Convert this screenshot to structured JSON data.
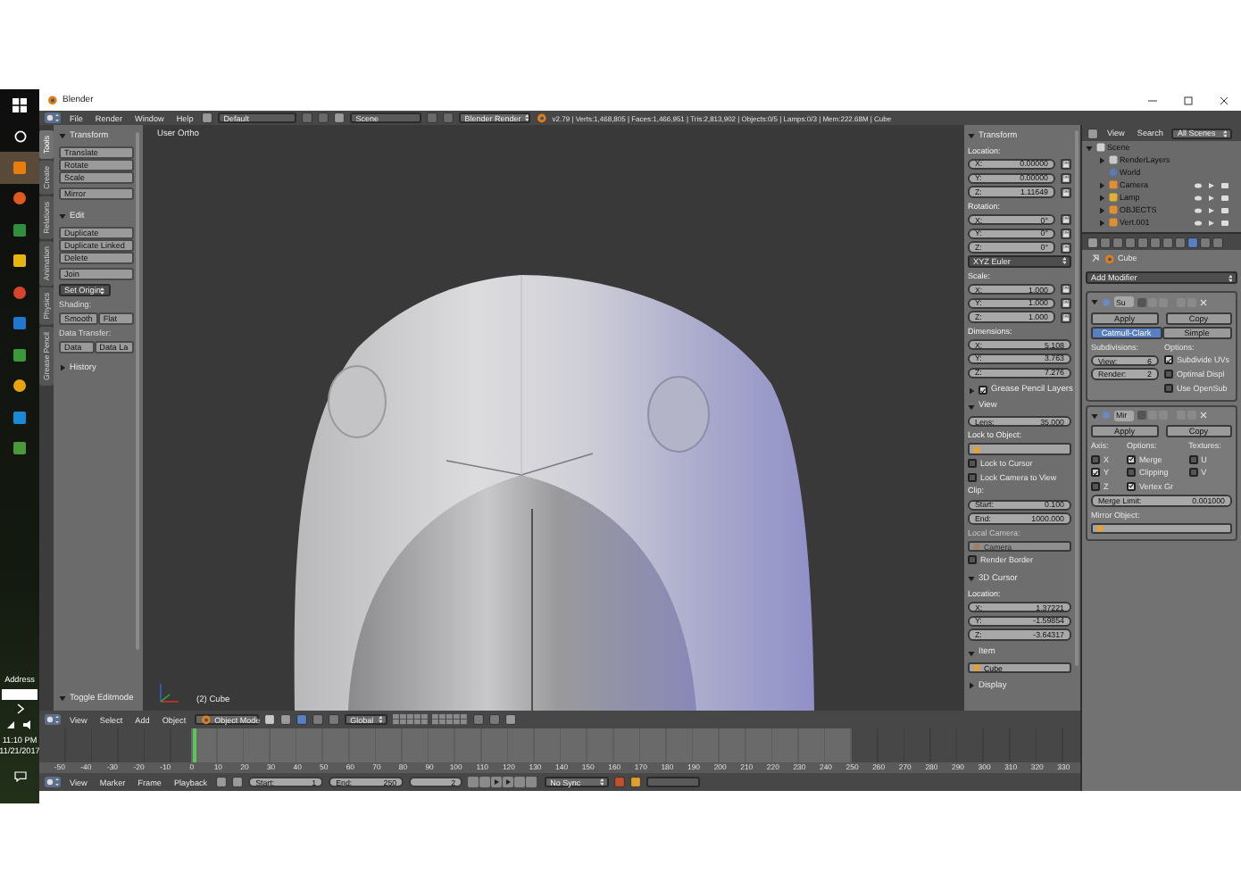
{
  "taskbar": {
    "apps": [
      {
        "selected": true
      },
      {
        "selected": false
      },
      {
        "selected": false
      },
      {
        "selected": false
      },
      {
        "selected": false
      },
      {
        "selected": false
      },
      {
        "selected": false
      },
      {
        "selected": false
      },
      {
        "selected": false
      },
      {
        "selected": false
      }
    ],
    "address_label": "Address",
    "time": "11:10 PM",
    "date": "11/21/2017"
  },
  "window": {
    "title": "Blender"
  },
  "info_header": {
    "menus": [
      "File",
      "Render",
      "Window",
      "Help"
    ],
    "layout": "Default",
    "scene": "Scene",
    "engine": "Blender Render",
    "stats": "v2.79 | Verts:1,468,805 | Faces:1,466,951 | Tris:2,813,902 | Objects:0/5 | Lamps:0/3 | Mem:222.68M | Cube"
  },
  "tool_shelf": {
    "tabs": [
      {
        "label": "Tools",
        "selected": true
      },
      {
        "label": "Create",
        "selected": false
      },
      {
        "label": "Relations",
        "selected": false
      },
      {
        "label": "Animation",
        "selected": false
      },
      {
        "label": "Physics",
        "selected": false
      },
      {
        "label": "Grease Pencil",
        "selected": false
      }
    ],
    "panels": [
      {
        "title": "Transform",
        "expanded": true,
        "items": [
          {
            "kind": "column",
            "labels": [
              "Translate",
              "Rotate",
              "Scale"
            ]
          },
          {
            "kind": "column",
            "labels": [
              "Mirror"
            ]
          }
        ]
      },
      {
        "title": "Edit",
        "expanded": true,
        "items": [
          {
            "kind": "column",
            "labels": [
              "Duplicate",
              "Duplicate Linked",
              "Delete"
            ]
          },
          {
            "kind": "column",
            "labels": [
              "Join"
            ]
          },
          {
            "kind": "dropdown",
            "label": "Set Origin"
          },
          {
            "kind": "label",
            "text": "Shading:"
          },
          {
            "kind": "row",
            "labels": [
              "Smooth",
              "Flat"
            ]
          },
          {
            "kind": "label",
            "text": "Data Transfer:"
          },
          {
            "kind": "row",
            "labels": [
              "Data",
              "Data La"
            ]
          }
        ]
      },
      {
        "title": "History",
        "expanded": false
      }
    ],
    "operator_panel": {
      "title": "Toggle Editmode",
      "expanded": true
    }
  },
  "viewport": {
    "view_label": "User Ortho",
    "object_label": "(2) Cube"
  },
  "n_panel": {
    "sections": [
      {
        "title": "Transform",
        "expanded": true,
        "rows": [
          {
            "kind": "label",
            "text": "Location:"
          },
          {
            "kind": "field",
            "label": "X:",
            "value": "0.00000",
            "lockable": true
          },
          {
            "kind": "field",
            "label": "Y:",
            "value": "0.00000",
            "lockable": true
          },
          {
            "kind": "field",
            "label": "Z:",
            "value": "1.11649",
            "lockable": true
          },
          {
            "kind": "label",
            "text": "Rotation:"
          },
          {
            "kind": "field",
            "label": "X:",
            "value": "0°",
            "lockable": true
          },
          {
            "kind": "field",
            "label": "Y:",
            "value": "0°",
            "lockable": true
          },
          {
            "kind": "field",
            "label": "Z:",
            "value": "0°",
            "lockable": true
          },
          {
            "kind": "dropdown",
            "text": "XYZ Euler"
          },
          {
            "kind": "label",
            "text": "Scale:"
          },
          {
            "kind": "field",
            "label": "X:",
            "value": "1.000",
            "lockable": true
          },
          {
            "kind": "field",
            "label": "Y:",
            "value": "1.000",
            "lockable": true
          },
          {
            "kind": "field",
            "label": "Z:",
            "value": "1.000",
            "lockable": true
          },
          {
            "kind": "label",
            "text": "Dimensions:"
          },
          {
            "kind": "field",
            "label": "X:",
            "value": "5.108",
            "lockable": false
          },
          {
            "kind": "field",
            "label": "Y:",
            "value": "3.763",
            "lockable": false
          },
          {
            "kind": "field",
            "label": "Z:",
            "value": "7.276",
            "lockable": false
          }
        ]
      },
      {
        "title": "Grease Pencil Layers",
        "expanded": false,
        "checked": true
      },
      {
        "title": "View",
        "expanded": true,
        "rows": [
          {
            "kind": "field",
            "label": "Lens:",
            "value": "35.000",
            "lockable": false
          },
          {
            "kind": "label",
            "text": "Lock to Object:"
          },
          {
            "kind": "object"
          },
          {
            "kind": "check",
            "text": "Lock to Cursor",
            "checked": false
          },
          {
            "kind": "check",
            "text": "Lock Camera to View",
            "checked": false
          },
          {
            "kind": "label",
            "text": "Clip:"
          },
          {
            "kind": "field",
            "label": "Start:",
            "value": "0.100",
            "lockable": false
          },
          {
            "kind": "field",
            "label": "End:",
            "value": "1000.000",
            "lockable": false
          },
          {
            "kind": "label",
            "text": "Local Camera:",
            "disabled": true
          },
          {
            "kind": "object",
            "text": "Camera",
            "disabled": true
          },
          {
            "kind": "check",
            "text": "Render Border",
            "checked": false
          }
        ]
      },
      {
        "title": "3D Cursor",
        "expanded": true,
        "rows": [
          {
            "kind": "label",
            "text": "Location:"
          },
          {
            "kind": "field",
            "label": "X:",
            "value": "1.37221",
            "lockable": false
          },
          {
            "kind": "field",
            "label": "Y:",
            "value": "-1.59854",
            "lockable": false
          },
          {
            "kind": "field",
            "label": "Z:",
            "value": "-3.64317",
            "lockable": false
          }
        ]
      },
      {
        "title": "Item",
        "expanded": true,
        "rows": [
          {
            "kind": "object",
            "text": "Cube"
          }
        ]
      },
      {
        "title": "Display",
        "expanded": false
      }
    ]
  },
  "outliner": {
    "view_menu": "View",
    "search_menu": "Search",
    "filter": "All Scenes",
    "tree": [
      {
        "label": "Scene",
        "kind": "scene",
        "expanded": true,
        "children": [
          {
            "label": "RenderLayers",
            "kind": "renderlayers",
            "expanded": false
          },
          {
            "label": "World",
            "kind": "world"
          },
          {
            "label": "Camera",
            "kind": "camera",
            "expanded": false
          },
          {
            "label": "Lamp",
            "kind": "lamp",
            "expanded": false
          },
          {
            "label": "OBJECTS",
            "kind": "mesh",
            "expanded": false
          },
          {
            "label": "Vert.001",
            "kind": "mesh",
            "expanded": false
          }
        ]
      }
    ]
  },
  "properties": {
    "object_name": "Cube",
    "add_modifier": "Add Modifier",
    "modifiers": [
      {
        "kind": "subsurf",
        "name": "Su",
        "apply": "Apply",
        "copy": "Copy",
        "types": [
          {
            "label": "Catmull-Clark",
            "selected": true
          },
          {
            "label": "Simple",
            "selected": false
          }
        ],
        "subdivisions_label": "Subdivisions:",
        "fields": [
          {
            "label": "View:",
            "value": "6"
          },
          {
            "label": "Render:",
            "value": "2"
          }
        ],
        "options_label": "Options:",
        "options": [
          {
            "label": "Subdivide UVs",
            "checked": true
          },
          {
            "label": "Optimal Displ",
            "checked": false
          },
          {
            "label": "Use OpenSub",
            "checked": false
          }
        ]
      },
      {
        "kind": "mirror",
        "name": "Mir",
        "apply": "Apply",
        "copy": "Copy",
        "axis_label": "Axis:",
        "axes": [
          {
            "label": "X",
            "checked": false
          },
          {
            "label": "Y",
            "checked": true
          },
          {
            "label": "Z",
            "checked": false
          }
        ],
        "options_label": "Options:",
        "options": [
          {
            "label": "Merge",
            "checked": true
          },
          {
            "label": "Clipping",
            "checked": false
          },
          {
            "label": "Vertex Gr",
            "checked": true
          }
        ],
        "textures_label": "Textures:",
        "textures": [
          {
            "label": "U",
            "checked": false
          },
          {
            "label": "V",
            "checked": false
          }
        ],
        "merge_limit": {
          "label": "Merge Limit:",
          "value": "0.001000"
        },
        "mirror_object_label": "Mirror Object:"
      }
    ]
  },
  "viewport_header": {
    "menus": [
      "View",
      "Select",
      "Add",
      "Object"
    ],
    "mode": "Object Mode",
    "orientation": "Global"
  },
  "timeline": {
    "ticks": [
      "-50",
      "-40",
      "-30",
      "-20",
      "-10",
      "0",
      "10",
      "20",
      "30",
      "40",
      "50",
      "60",
      "70",
      "80",
      "90",
      "100",
      "110",
      "120",
      "130",
      "140",
      "150",
      "160",
      "170",
      "180",
      "190",
      "200",
      "210",
      "220",
      "230",
      "240",
      "250",
      "260",
      "270",
      "280",
      "290",
      "300",
      "310",
      "320",
      "330"
    ],
    "header": {
      "menus": [
        "View",
        "Marker",
        "Frame",
        "Playback"
      ],
      "start": {
        "label": "Start:",
        "value": "1"
      },
      "end": {
        "label": "End:",
        "value": "250"
      },
      "current": "2",
      "sync": "No Sync"
    }
  }
}
